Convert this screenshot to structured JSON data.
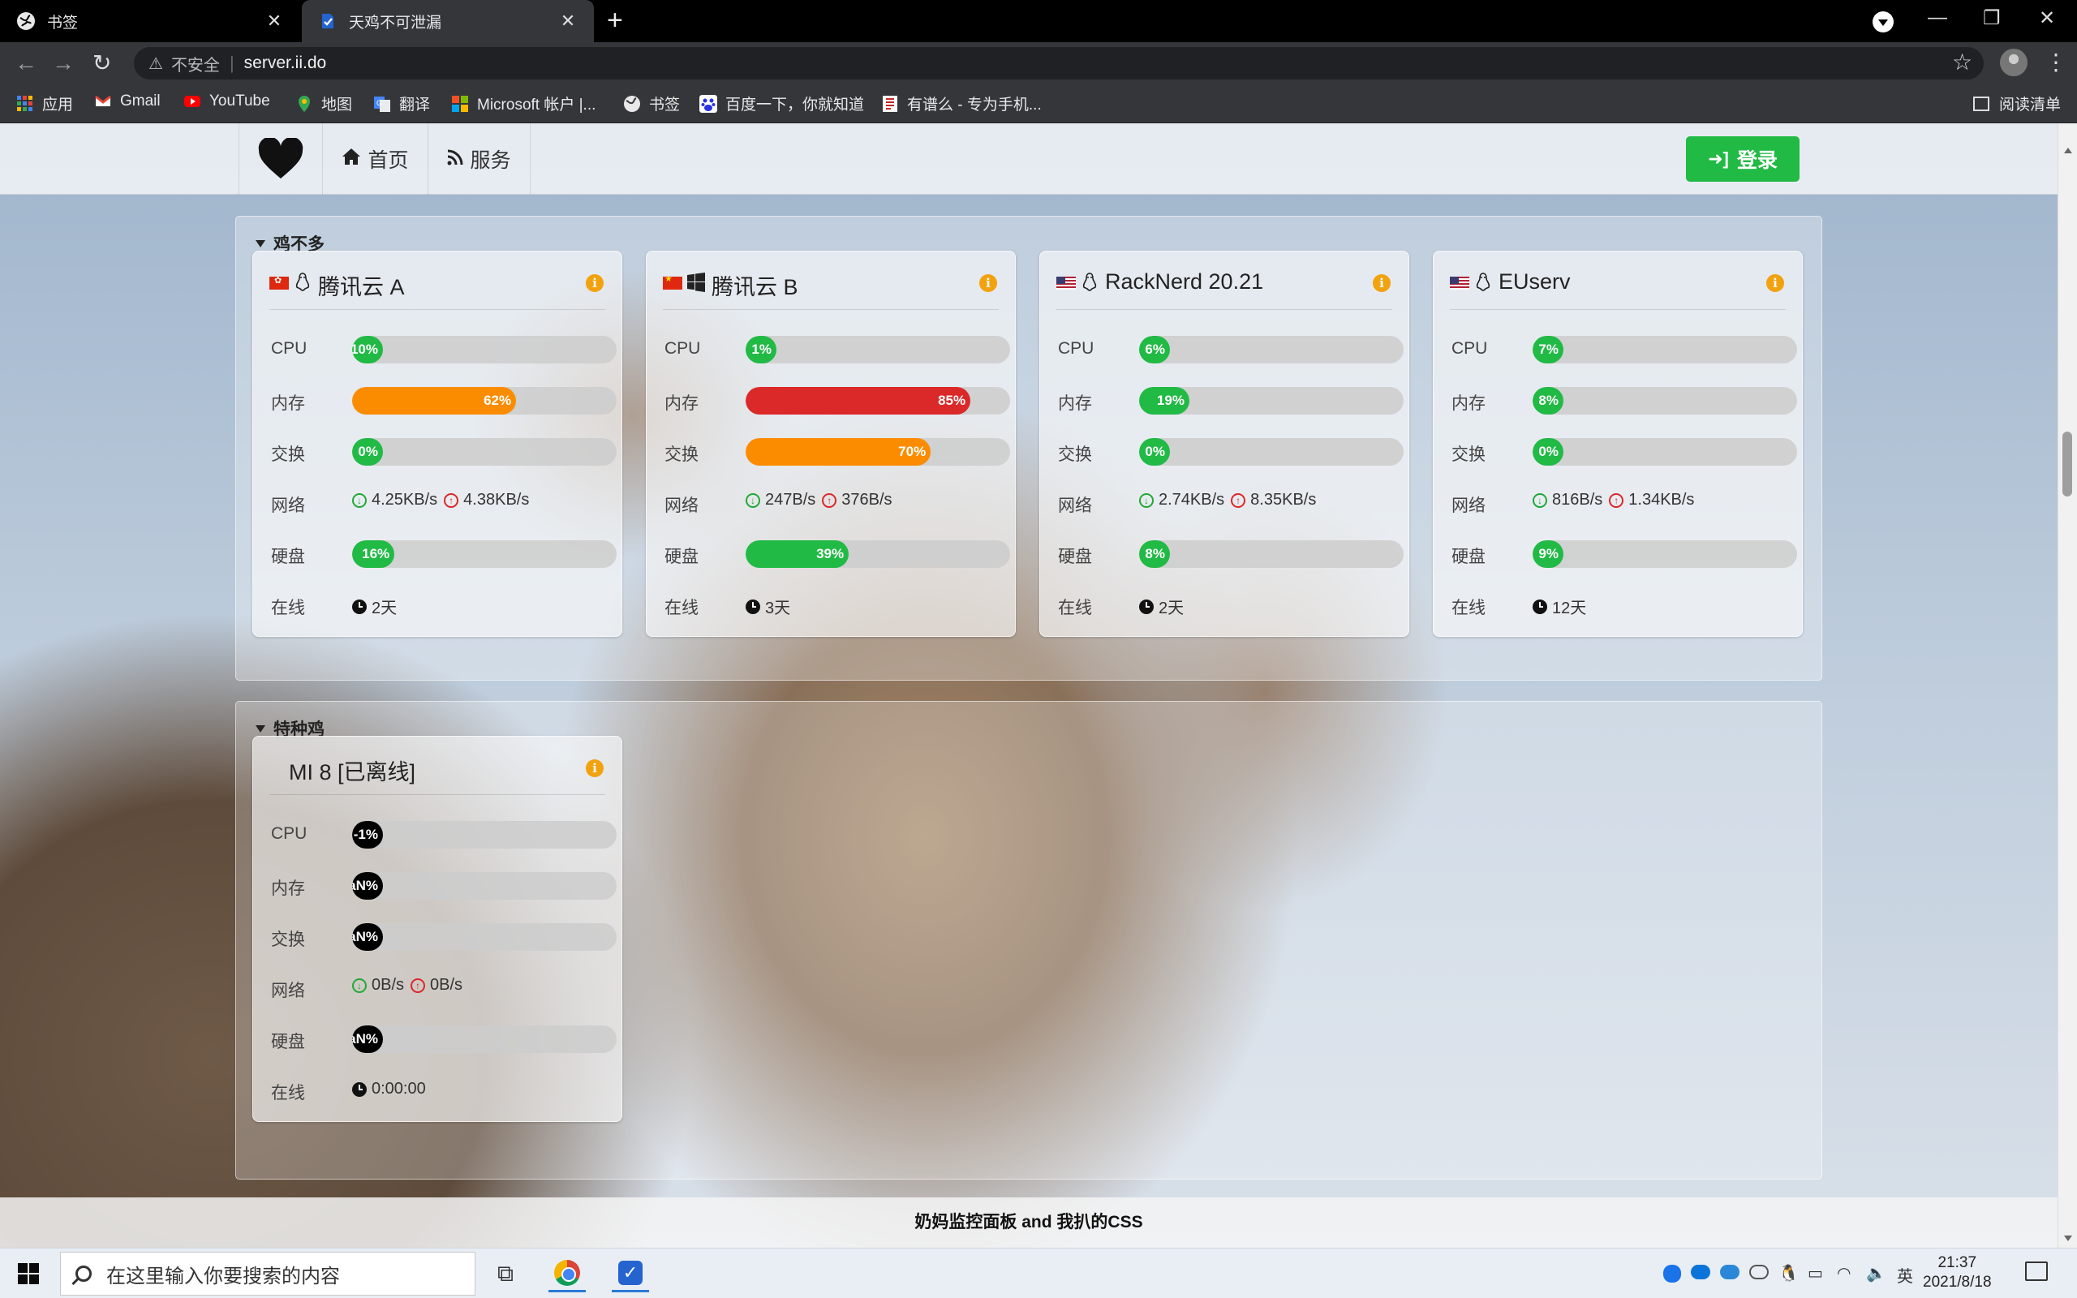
{
  "browser": {
    "tabs": [
      {
        "title": "书签",
        "active": false
      },
      {
        "title": "天鸡不可泄漏",
        "active": true
      }
    ],
    "address": {
      "security_label": "不安全",
      "url": "server.ii.do"
    },
    "bookmarks": [
      {
        "label": "应用",
        "icon": "apps-grid-icon",
        "color": "#e8453c"
      },
      {
        "label": "Gmail",
        "icon": "gmail-icon",
        "color": "#ea4335"
      },
      {
        "label": "YouTube",
        "icon": "youtube-icon",
        "color": "#ff0000"
      },
      {
        "label": "地图",
        "icon": "maps-pin-icon",
        "color": "#34a853"
      },
      {
        "label": "翻译",
        "icon": "translate-icon",
        "color": "#4285f4"
      },
      {
        "label": "Microsoft 帐户 |...",
        "icon": "microsoft-icon",
        "color": "#f25022"
      },
      {
        "label": "书签",
        "icon": "globe-icon",
        "color": "#ffffff"
      },
      {
        "label": "百度一下，你就知道",
        "icon": "baidu-paw-icon",
        "color": "#2932e1"
      },
      {
        "label": "有谱么 - 专为手机...",
        "icon": "youpu-icon",
        "color": "#c62828"
      }
    ],
    "reading_list": "阅读清单"
  },
  "nav": {
    "home": "首页",
    "services": "服务",
    "login": "登录"
  },
  "colors": {
    "green": "#21ba45",
    "orange": "#fb8c00",
    "red": "#db2828",
    "black": "#000000",
    "info": "#f2a20e"
  },
  "labels": {
    "cpu": "CPU",
    "mem": "内存",
    "swap": "交换",
    "net": "网络",
    "disk": "硬盘",
    "uptime": "在线"
  },
  "groups": [
    {
      "title": "鸡不多",
      "servers": [
        {
          "name": "腾讯云 A",
          "flag": "hk",
          "os": "linux-penguin-icon",
          "cpu": {
            "pct": 10,
            "text": "10%",
            "color": "green"
          },
          "mem": {
            "pct": 62,
            "text": "62%",
            "color": "orange"
          },
          "swap": {
            "pct": 0,
            "text": "0%",
            "color": "green"
          },
          "net_in": "4.25KB/s",
          "net_out": "4.38KB/s",
          "disk": {
            "pct": 16,
            "text": "16%",
            "color": "green"
          },
          "uptime": "2天"
        },
        {
          "name": "腾讯云 B",
          "flag": "cn",
          "os": "windows-logo-icon",
          "cpu": {
            "pct": 1,
            "text": "1%",
            "color": "green"
          },
          "mem": {
            "pct": 85,
            "text": "85%",
            "color": "red"
          },
          "swap": {
            "pct": 70,
            "text": "70%",
            "color": "orange"
          },
          "net_in": "247B/s",
          "net_out": "376B/s",
          "disk": {
            "pct": 39,
            "text": "39%",
            "color": "green"
          },
          "uptime": "3天"
        },
        {
          "name": "RackNerd 20.21",
          "flag": "us",
          "os": "linux-penguin-icon",
          "cpu": {
            "pct": 6,
            "text": "6%",
            "color": "green"
          },
          "mem": {
            "pct": 19,
            "text": "19%",
            "color": "green"
          },
          "swap": {
            "pct": 0,
            "text": "0%",
            "color": "green"
          },
          "net_in": "2.74KB/s",
          "net_out": "8.35KB/s",
          "disk": {
            "pct": 8,
            "text": "8%",
            "color": "green"
          },
          "uptime": "2天"
        },
        {
          "name": "EUserv",
          "flag": "us",
          "os": "linux-penguin-icon",
          "cpu": {
            "pct": 7,
            "text": "7%",
            "color": "green"
          },
          "mem": {
            "pct": 8,
            "text": "8%",
            "color": "green"
          },
          "swap": {
            "pct": 0,
            "text": "0%",
            "color": "green"
          },
          "net_in": "816B/s",
          "net_out": "1.34KB/s",
          "disk": {
            "pct": 9,
            "text": "9%",
            "color": "green"
          },
          "uptime": "12天"
        }
      ]
    },
    {
      "title": "特种鸡",
      "servers": [
        {
          "name": "MI 8 [已离线]",
          "flag": "",
          "os": "",
          "cpu": {
            "pct": 0,
            "text": "-1%",
            "color": "black"
          },
          "mem": {
            "pct": 0,
            "text": "NaN%",
            "color": "black"
          },
          "swap": {
            "pct": 0,
            "text": "NaN%",
            "color": "black"
          },
          "net_in": "0B/s",
          "net_out": "0B/s",
          "disk": {
            "pct": 0,
            "text": "NaN%",
            "color": "black"
          },
          "uptime": "0:00:00"
        }
      ]
    }
  ],
  "footer": "奶妈监控面板 and 我扒的CSS",
  "taskbar": {
    "search_placeholder": "在这里输入你要搜索的内容",
    "ime": "英",
    "time": "21:37",
    "date": "2021/8/18"
  }
}
